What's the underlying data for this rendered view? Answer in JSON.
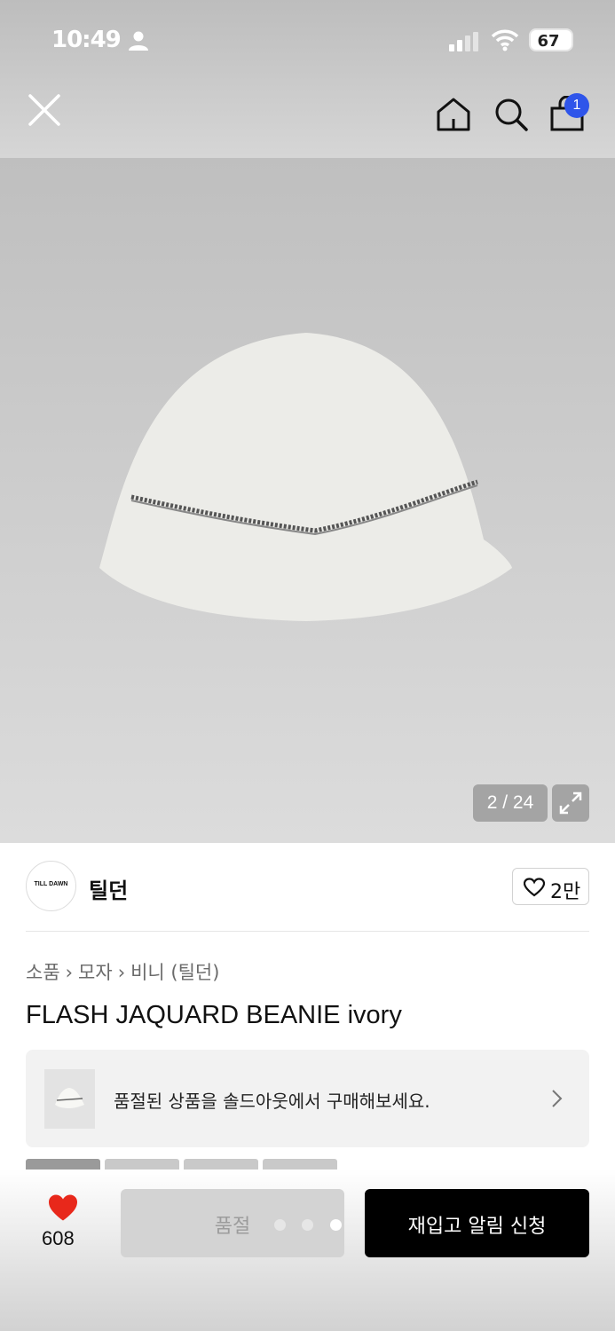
{
  "status_bar": {
    "time": "10:49",
    "battery": "67",
    "icons": [
      "person-icon",
      "signal-icon",
      "wifi-icon",
      "battery-icon"
    ]
  },
  "top_nav": {
    "icons": [
      "close-icon",
      "home-icon",
      "search-icon",
      "cart-icon"
    ],
    "cart_badge": "1",
    "accent_color": "#2f55ea"
  },
  "gallery": {
    "counter": "2 / 24",
    "expand_icon": "expand-icon"
  },
  "brand": {
    "logo_text": "TILL DAWN",
    "name": "틸던",
    "like_count": "2만"
  },
  "breadcrumb": [
    "소품",
    "모자",
    "비니 (틸던)"
  ],
  "product": {
    "title": "FLASH JAQUARD BEANIE ivory"
  },
  "soldout_banner": {
    "text": "품절된 상품을 솔드아웃에서 구매해보세요."
  },
  "bottom_bar": {
    "wish_count": "608",
    "soldout_label": "품절",
    "restock_label": "재입고 알림 신청",
    "wish_color": "#e8281b"
  }
}
